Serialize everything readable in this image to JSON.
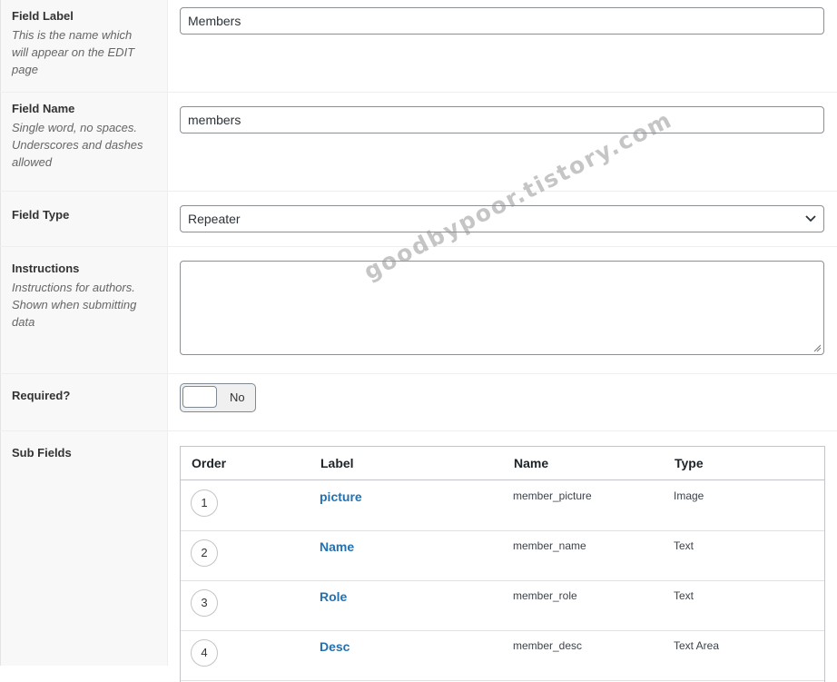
{
  "fields": {
    "field_label": {
      "label": "Field Label",
      "desc_lines": [
        "This is the name which",
        "will appear on the EDIT",
        "page"
      ],
      "value": "Members"
    },
    "field_name": {
      "label": "Field Name",
      "desc_lines": [
        "Single word, no spaces.",
        "Underscores and dashes",
        "allowed"
      ],
      "value": "members"
    },
    "field_type": {
      "label": "Field Type",
      "value": "Repeater",
      "icon": "chevron-down-icon"
    },
    "instructions": {
      "label": "Instructions",
      "desc_lines": [
        "Instructions for authors.",
        "Shown when submitting",
        "data"
      ],
      "value": ""
    },
    "required": {
      "label": "Required?",
      "toggle_text": "No",
      "checked": false
    },
    "sub_fields": {
      "label": "Sub Fields",
      "columns": [
        "Order",
        "Label",
        "Name",
        "Type"
      ],
      "rows": [
        {
          "order": "1",
          "label": "picture",
          "name": "member_picture",
          "type": "Image"
        },
        {
          "order": "2",
          "label": "Name",
          "name": "member_name",
          "type": "Text"
        },
        {
          "order": "3",
          "label": "Role",
          "name": "member_role",
          "type": "Text"
        },
        {
          "order": "4",
          "label": "Desc",
          "name": "member_desc",
          "type": "Text Area"
        }
      ]
    }
  },
  "watermark": "goodbypoor.tistory.com",
  "colors": {
    "link": "#2271b1",
    "label_bg": "#f8f8f8",
    "border": "#8c8f94"
  }
}
